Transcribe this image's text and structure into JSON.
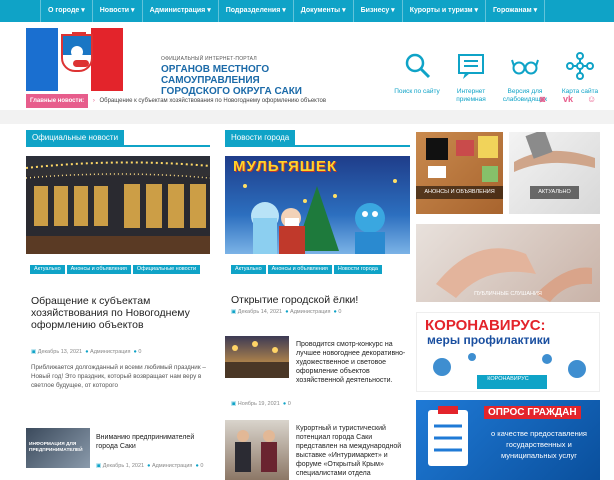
{
  "nav": {
    "items": [
      {
        "label": "О городе ▾"
      },
      {
        "label": "Новости ▾"
      },
      {
        "label": "Администрация ▾"
      },
      {
        "label": "Подразделения ▾"
      },
      {
        "label": "Документы ▾"
      },
      {
        "label": "Бизнесу ▾"
      },
      {
        "label": "Курорты и туризм ▾"
      },
      {
        "label": "Горожанам ▾"
      }
    ]
  },
  "header": {
    "portal": "ОФИЦИАЛЬНЫЙ ИНТЕРНЕТ-ПОРТАЛ",
    "title": "ОРГАНОВ МЕСТНОГО САМОУПРАВЛЕНИЯ ГОРОДСКОГО ОКРУГА САКИ",
    "flag_colors": [
      "#1a6fd0",
      "#ffffff",
      "#e3242b"
    ],
    "icons": [
      {
        "name": "search-icon",
        "label": "Поиск по сайту"
      },
      {
        "name": "reception-icon",
        "label": "Интернет приемная"
      },
      {
        "name": "glasses-icon",
        "label": "Версия для слабовидящих"
      },
      {
        "name": "sitemap-icon",
        "label": "Карта сайта"
      }
    ]
  },
  "ticker": {
    "tag": "Главные новости:",
    "text": "Обращение к субъектам хозяйствования по Новогоднему оформлению объектов"
  },
  "social": {
    "rss": "◙",
    "vk": "vk",
    "ok": "☺",
    "rss_color": "#e75d8c",
    "vk_color": "#e75d8c",
    "ok_color": "#e75d8c"
  },
  "official": {
    "heading": "Официальные новости",
    "lead": {
      "badges": [
        "Актуально",
        "Анонсы и объявления",
        "Официальные новости"
      ],
      "title": "Обращение к субъектам хозяйствования по Новогоднему оформлению объектов",
      "date": "Декабрь 13, 2021",
      "author": "Администрация",
      "comments": "0",
      "excerpt": "Приближается долгожданный и всеми любимый праздник – Новый год! Это праздник, который возвращает нам веру в светлое будущее, от которого"
    },
    "small": {
      "title": "Вниманию предпринимателей города Саки",
      "date": "Декабрь 1, 2021",
      "author": "Администрация",
      "comments": "0",
      "thumb_text": "ИНФОРМАЦИЯ ДЛЯ ПРЕДПРИНИМАТЕЛЕЙ"
    }
  },
  "city": {
    "heading": "Новости города",
    "img_text": "МУЛЬТЯШЕК",
    "lead": {
      "badges": [
        "Актуально",
        "Анонсы и объявления",
        "Новости города"
      ],
      "title": "Открытие городской ёлки!",
      "date": "Декабрь 14, 2021",
      "author": "Администрация",
      "comments": "0"
    },
    "s1": {
      "title": "Проводится смотр-конкурс на лучшее новогоднее декоративно-художественное и световое оформление объектов хозяйственной деятельности.",
      "date": "Ноябрь 19, 2021",
      "comments": "0"
    },
    "s2": {
      "title": "Курортный и туристический потенциал города Саки представлен на международной выставке «Интуримаркет» и форуме «Открытый Крым» специалистами отдела"
    }
  },
  "tiles": {
    "t1": "АНОНСЫ И ОБЪЯВЛЕНИЯ",
    "t2": "АКТУАЛЬНО",
    "t3": "ПУБЛИЧНЫЕ СЛУШАНИЯ",
    "t4_title": "КОРОНАВИРУС:",
    "t4_sub": "меры профилактики",
    "t4_cap": "КОРОНАВИРУС",
    "t5_title": "ОПРОС ГРАЖДАН",
    "t5_sub": "о качестве предоставления государственных и муниципальных услуг"
  }
}
